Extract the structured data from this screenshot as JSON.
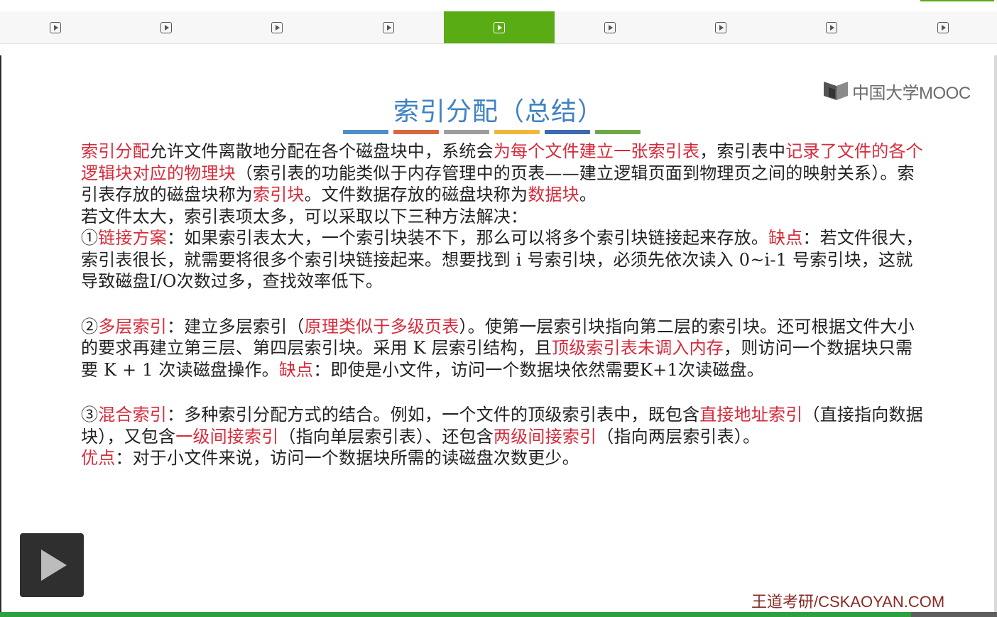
{
  "nav": {
    "tab_count": 9,
    "active_index": 4,
    "tabs": [
      {
        "icon": "play-box-icon"
      },
      {
        "icon": "play-box-icon"
      },
      {
        "icon": "play-box-icon"
      },
      {
        "icon": "play-box-icon"
      },
      {
        "icon": "play-box-icon"
      },
      {
        "icon": "play-box-icon"
      },
      {
        "icon": "play-box-icon"
      },
      {
        "icon": "play-box-icon"
      },
      {
        "icon": "play-box-icon"
      }
    ],
    "active_color": "#5aac14"
  },
  "logo": {
    "text": "中国大学MOOC"
  },
  "slide": {
    "title": "索引分配（总结）",
    "underline_colors": [
      "#4f8ec8",
      "#d8693f",
      "#9c9c9c",
      "#f1b63b",
      "#3d69b0",
      "#6ea845"
    ],
    "highlight_color": "#d62b3b",
    "paragraphs": [
      {
        "segments": [
          {
            "t": "索引分配",
            "hl": true
          },
          {
            "t": "允许文件离散地分配在各个磁盘块中，系统会",
            "hl": false
          },
          {
            "t": "为每个文件建立一张索引表",
            "hl": true
          },
          {
            "t": "，索引表中",
            "hl": false
          },
          {
            "t": "记录了文件的各个逻辑块对应的物理块",
            "hl": true
          },
          {
            "t": "（索引表的功能类似于内存管理中的页表——建立逻辑页面到物理页之间的映射关系）。索引表存放的磁盘块称为",
            "hl": false
          },
          {
            "t": "索引块",
            "hl": true
          },
          {
            "t": "。文件数据存放的磁盘块称为",
            "hl": false
          },
          {
            "t": "数据块",
            "hl": true
          },
          {
            "t": "。",
            "hl": false
          }
        ]
      },
      {
        "segments": [
          {
            "t": "若文件太大，索引表项太多，可以采取以下三种方法解决：",
            "hl": false
          }
        ]
      },
      {
        "segments": [
          {
            "t": "①",
            "hl": false
          },
          {
            "t": "链接方案",
            "hl": true
          },
          {
            "t": "：如果索引表太大，一个索引块装不下，那么可以将多个索引块链接起来存放。",
            "hl": false
          },
          {
            "t": "缺点",
            "hl": true
          },
          {
            "t": "：若文件很大，索引表很长，就需要将很多个索引块链接起来。想要找到 i 号索引块，必须先依次读入 0~i-1 号索引块，这就导致磁盘I/O次数过多，查找效率低下。",
            "hl": false
          }
        ],
        "gap_after": true
      },
      {
        "segments": [
          {
            "t": "②",
            "hl": false
          },
          {
            "t": "多层索引",
            "hl": true
          },
          {
            "t": "：建立多层索引（",
            "hl": false
          },
          {
            "t": "原理类似于多级页表",
            "hl": true
          },
          {
            "t": "）。使第一层索引块指向第二层的索引块。还可根据文件大小的要求再建立第三层、第四层索引块。采用 K 层索引结构，且",
            "hl": false
          },
          {
            "t": "顶级索引表未调入内存",
            "hl": true
          },
          {
            "t": "，则访问一个数据块只需要 K + 1 次读磁盘操作。",
            "hl": false
          },
          {
            "t": "缺点",
            "hl": true
          },
          {
            "t": "：即使是小文件，访问一个数据块依然需要K+1次读磁盘。",
            "hl": false
          }
        ],
        "gap_after": true
      },
      {
        "segments": [
          {
            "t": "③",
            "hl": false
          },
          {
            "t": "混合索引",
            "hl": true
          },
          {
            "t": "：多种索引分配方式的结合。例如，一个文件的顶级索引表中，既包含",
            "hl": false
          },
          {
            "t": "直接地址索引",
            "hl": true
          },
          {
            "t": "（直接指向数据块），又包含",
            "hl": false
          },
          {
            "t": "一级间接索引",
            "hl": true
          },
          {
            "t": "（指向单层索引表）、还包含",
            "hl": false
          },
          {
            "t": "两级间接索引",
            "hl": true
          },
          {
            "t": "（指向两层索引表）。",
            "hl": false
          }
        ]
      },
      {
        "segments": [
          {
            "t": "优点",
            "hl": true
          },
          {
            "t": "：对于小文件来说，访问一个数据块所需的读磁盘次数更少。",
            "hl": false
          }
        ]
      }
    ]
  },
  "watermark": "王道考研/CSKAOYAN.COM",
  "player": {
    "play_icon": "play-icon",
    "progress_fraction": 0.914
  }
}
